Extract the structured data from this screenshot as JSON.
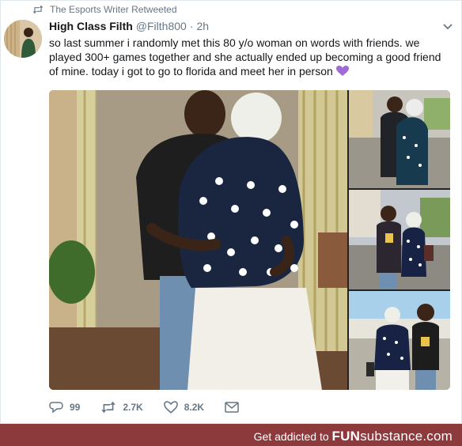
{
  "retweet_banner": {
    "text": "The Esports Writer Retweeted",
    "icon": "retweet-icon"
  },
  "tweet": {
    "display_name": "High Class Filth",
    "handle": "@Filth800",
    "separator": "·",
    "time": "2h",
    "text": "so last summer i randomly met this 80 y/o woman on words with friends. we played 300+ games together and she actually ended up becoming a good friend of mine. today i got to go to florida and meet her in person",
    "emoji": "purple-heart-icon",
    "media_count": 4
  },
  "actions": {
    "reply": {
      "icon": "reply-icon",
      "count": "99"
    },
    "retweet": {
      "icon": "retweet-icon",
      "count": "2.7K"
    },
    "like": {
      "icon": "heart-icon",
      "count": "8.2K"
    },
    "dm": {
      "icon": "envelope-icon"
    }
  },
  "footer": {
    "prefix": "Get addicted to",
    "brand_bold": "FUN",
    "brand_light": "substance",
    "suffix": ".com"
  },
  "colors": {
    "text_primary": "#14171a",
    "text_secondary": "#657786",
    "border": "#e1e8ed",
    "footer_bg": "#8c3a3c",
    "emoji_purple": "#a06bd6"
  }
}
